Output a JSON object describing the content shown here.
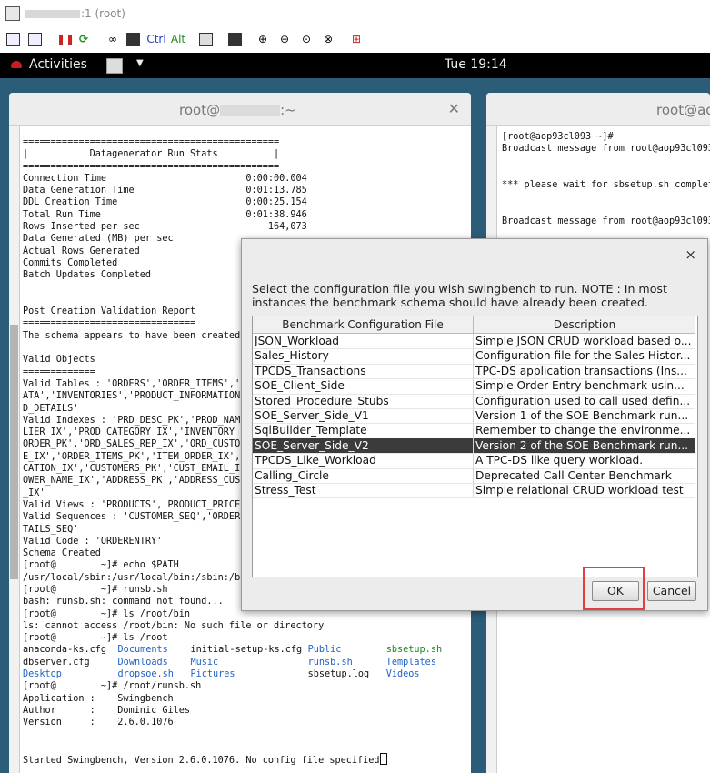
{
  "window": {
    "title": ":1 (root)"
  },
  "toolbar": {
    "ctrl_label": "Ctrl",
    "alt_label": "Alt"
  },
  "topbar": {
    "activities": "Activities",
    "clock": "Tue 19:14"
  },
  "term1": {
    "title_prefix": "root@",
    "title_suffix": ":~",
    "lines": [
      "==============================================",
      "|           Datagenerator Run Stats          |",
      "==============================================",
      "Connection Time                         0:00:00.004",
      "Data Generation Time                    0:01:13.785",
      "DDL Creation Time                       0:00:25.154",
      "Total Run Time                          0:01:38.946",
      "Rows Inserted per sec                       164,073",
      "Data Generated (MB) per sec",
      "Actual Rows Generated",
      "Commits Completed",
      "Batch Updates Completed",
      "",
      "",
      "Post Creation Validation Report",
      "===============================",
      "The schema appears to have been created",
      "",
      "Valid Objects",
      "=============",
      "Valid Tables : 'ORDERS','ORDER_ITEMS','",
      "ATA','INVENTORIES','PRODUCT_INFORMATION",
      "D_DETAILS'",
      "Valid Indexes : 'PRD_DESC_PK','PROD_NAM",
      "LIER_IX','PROD_CATEGORY_IX','INVENTORY_",
      "ORDER_PK','ORD_SALES_REP_IX','ORD_CUSTO",
      "E_IX','ORDER_ITEMS_PK','ITEM_ORDER_IX',",
      "CATION_IX','CUSTOMERS_PK','CUST_EMAIL_I",
      "OWER_NAME_IX','ADDRESS_PK','ADDRESS_CUS",
      "_IX'",
      "Valid Views : 'PRODUCTS','PRODUCT_PRICE",
      "Valid Sequences : 'CUSTOMER_SEQ','ORDER",
      "TAILS_SEQ'",
      "Valid Code : 'ORDERENTRY'",
      "Schema Created",
      "[root@        ~]# echo $PATH",
      "/usr/local/sbin:/usr/local/bin:/sbin:/b",
      "[root@        ~]# runsb.sh",
      "bash: runsb.sh: command not found...",
      "[root@        ~]# ls /root/bin",
      "ls: cannot access /root/bin: No such file or directory",
      "[root@        ~]# ls /root"
    ],
    "ls_rows": [
      [
        {
          "t": "anaconda-ks.cfg",
          "c": ""
        },
        {
          "t": "Documents",
          "c": "blue"
        },
        {
          "t": "initial-setup-ks.cfg",
          "c": ""
        },
        {
          "t": "Public",
          "c": "blue"
        },
        {
          "t": "sbsetup.sh",
          "c": "green"
        }
      ],
      [
        {
          "t": "dbserver.cfg",
          "c": ""
        },
        {
          "t": "Downloads",
          "c": "blue"
        },
        {
          "t": "Music",
          "c": "blue"
        },
        {
          "t": "runsb.sh",
          "c": "blue"
        },
        {
          "t": "Templates",
          "c": "blue"
        }
      ],
      [
        {
          "t": "Desktop",
          "c": "blue"
        },
        {
          "t": "dropsoe.sh",
          "c": "blue"
        },
        {
          "t": "Pictures",
          "c": "blue"
        },
        {
          "t": "sbsetup.log",
          "c": ""
        },
        {
          "t": "Videos",
          "c": "blue"
        }
      ]
    ],
    "lines_after": [
      "[root@        ~]# /root/runsb.sh",
      "Application :    Swingbench",
      "Author      :    Dominic Giles",
      "Version     :    2.6.0.1076",
      "",
      "",
      "Started Swingbench, Version 2.6.0.1076. No config file specified"
    ]
  },
  "term2": {
    "title": "root@ao",
    "lines": [
      "[root@aop93cl093 ~]#",
      "Broadcast message from root@aop93cl093",
      "",
      "",
      "*** please wait for sbsetup.sh complet",
      "",
      "",
      "Broadcast message from root@aop93cl093"
    ]
  },
  "dialog": {
    "close_glyph": "×",
    "message": "Select the configuration file you wish swingbench to run. NOTE : In most instances the benchmark schema should have already been created.",
    "columns": [
      "Benchmark Configuration File",
      "Description"
    ],
    "rows": [
      {
        "file": "JSON_Workload",
        "desc": "Simple JSON CRUD workload based o..."
      },
      {
        "file": "Sales_History",
        "desc": "Configuration file for the Sales Histor..."
      },
      {
        "file": "TPCDS_Transactions",
        "desc": "TPC-DS application transactions (Ins..."
      },
      {
        "file": "SOE_Client_Side",
        "desc": "Simple Order Entry benchmark usin..."
      },
      {
        "file": "Stored_Procedure_Stubs",
        "desc": "Configuration used to call used defin..."
      },
      {
        "file": "SOE_Server_Side_V1",
        "desc": "Version 1 of the SOE Benchmark run..."
      },
      {
        "file": "SqlBuilder_Template",
        "desc": "Remember to change the environme..."
      },
      {
        "file": "SOE_Server_Side_V2",
        "desc": "Version 2 of the SOE Benchmark run..."
      },
      {
        "file": "TPCDS_Like_Workload",
        "desc": "A TPC-DS like query workload."
      },
      {
        "file": "Calling_Circle",
        "desc": "Deprecated Call Center Benchmark"
      },
      {
        "file": "Stress_Test",
        "desc": "Simple relational CRUD workload test"
      }
    ],
    "selected_index": 7,
    "ok_label": "OK",
    "cancel_label": "Cancel"
  }
}
